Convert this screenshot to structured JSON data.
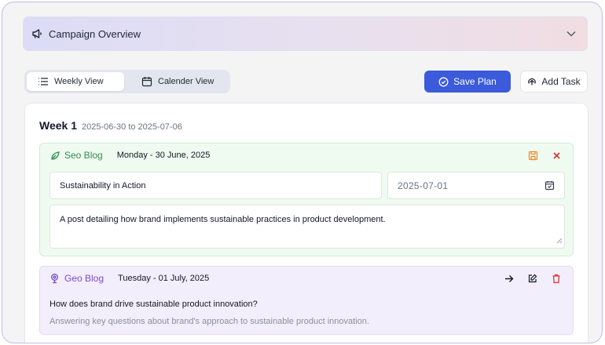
{
  "accordion": {
    "title": "Campaign Overview"
  },
  "view_toggle": {
    "weekly_label": "Weekly View",
    "calendar_label": "Calender View",
    "active": "Weekly View"
  },
  "toolbar": {
    "save_label": "Save Plan",
    "add_label": "Add Task"
  },
  "week": {
    "label": "Week 1",
    "range": "2025-06-30 to 2025-07-06"
  },
  "tasks": [
    {
      "type": "Seo Blog",
      "date": "Monday - 30 June, 2025",
      "title_value": "Sustainability in Action",
      "due_date_value": "2025-07-01",
      "description_value": "A post detailing how brand implements sustainable practices in product development.",
      "actions": [
        "save-icon",
        "close-icon"
      ]
    },
    {
      "type": "Geo Blog",
      "date": "Tuesday - 01 July, 2025",
      "question": "How does brand drive sustainable product innovation?",
      "answer": "Answering key questions about brand's approach to sustainable product innovation.",
      "actions": [
        "arrow-right-icon",
        "edit-icon",
        "trash-icon"
      ]
    }
  ],
  "colors": {
    "primary": "#3b5bdb",
    "seo_accent": "#2f8f4e",
    "geo_accent": "#7c4bc7",
    "danger": "#e03131",
    "save_icon": "#f08c2e"
  }
}
